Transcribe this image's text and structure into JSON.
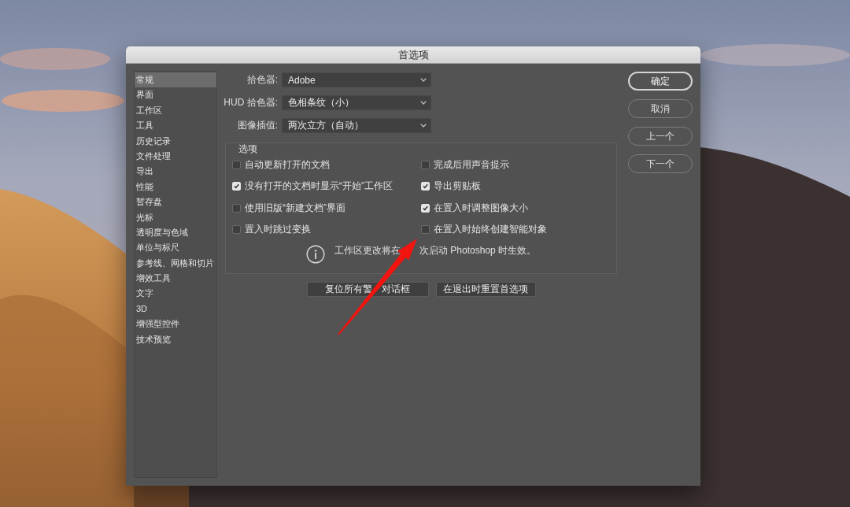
{
  "window": {
    "title": "首选项"
  },
  "sidebar": {
    "items": [
      {
        "label": "常规",
        "selected": true
      },
      {
        "label": "界面",
        "selected": false
      },
      {
        "label": "工作区",
        "selected": false
      },
      {
        "label": "工具",
        "selected": false
      },
      {
        "label": "历史记录",
        "selected": false
      },
      {
        "label": "文件处理",
        "selected": false
      },
      {
        "label": "导出",
        "selected": false
      },
      {
        "label": "性能",
        "selected": false
      },
      {
        "label": "暂存盘",
        "selected": false
      },
      {
        "label": "光标",
        "selected": false
      },
      {
        "label": "透明度与色域",
        "selected": false
      },
      {
        "label": "单位与标尺",
        "selected": false
      },
      {
        "label": "参考线、网格和切片",
        "selected": false
      },
      {
        "label": "增效工具",
        "selected": false
      },
      {
        "label": "文字",
        "selected": false
      },
      {
        "label": "3D",
        "selected": false
      },
      {
        "label": "增强型控件",
        "selected": false
      },
      {
        "label": "技术预览",
        "selected": false
      }
    ]
  },
  "pickers": [
    {
      "label": "拾色器:",
      "value": "Adobe"
    },
    {
      "label": "HUD 拾色器:",
      "value": "色相条纹（小）"
    },
    {
      "label": "图像插值:",
      "value": "两次立方（自动）"
    }
  ],
  "options": {
    "title": "选项",
    "checkboxes": [
      {
        "label": "自动更新打开的文档",
        "checked": false
      },
      {
        "label": "完成后用声音提示",
        "checked": false
      },
      {
        "label": "没有打开的文档时显示“开始”工作区",
        "checked": true
      },
      {
        "label": "导出剪贴板",
        "checked": true
      },
      {
        "label": "使用旧版“新建文档”界面",
        "checked": false
      },
      {
        "label": "在置入时调整图像大小",
        "checked": true
      },
      {
        "label": "置入时跳过变换",
        "checked": false
      },
      {
        "label": "在置入时始终创建智能对象",
        "checked": false
      }
    ],
    "note": "工作区更改将在　　次启动 Photoshop 时生效。"
  },
  "reset_buttons": [
    {
      "label": "复位所有警　对话框"
    },
    {
      "label": "在退出时重置首选项"
    }
  ],
  "dialog_buttons": [
    {
      "label": "确定",
      "default": true
    },
    {
      "label": "取消",
      "default": false
    },
    {
      "label": "上一个",
      "default": false
    },
    {
      "label": "下一个",
      "default": false
    }
  ]
}
